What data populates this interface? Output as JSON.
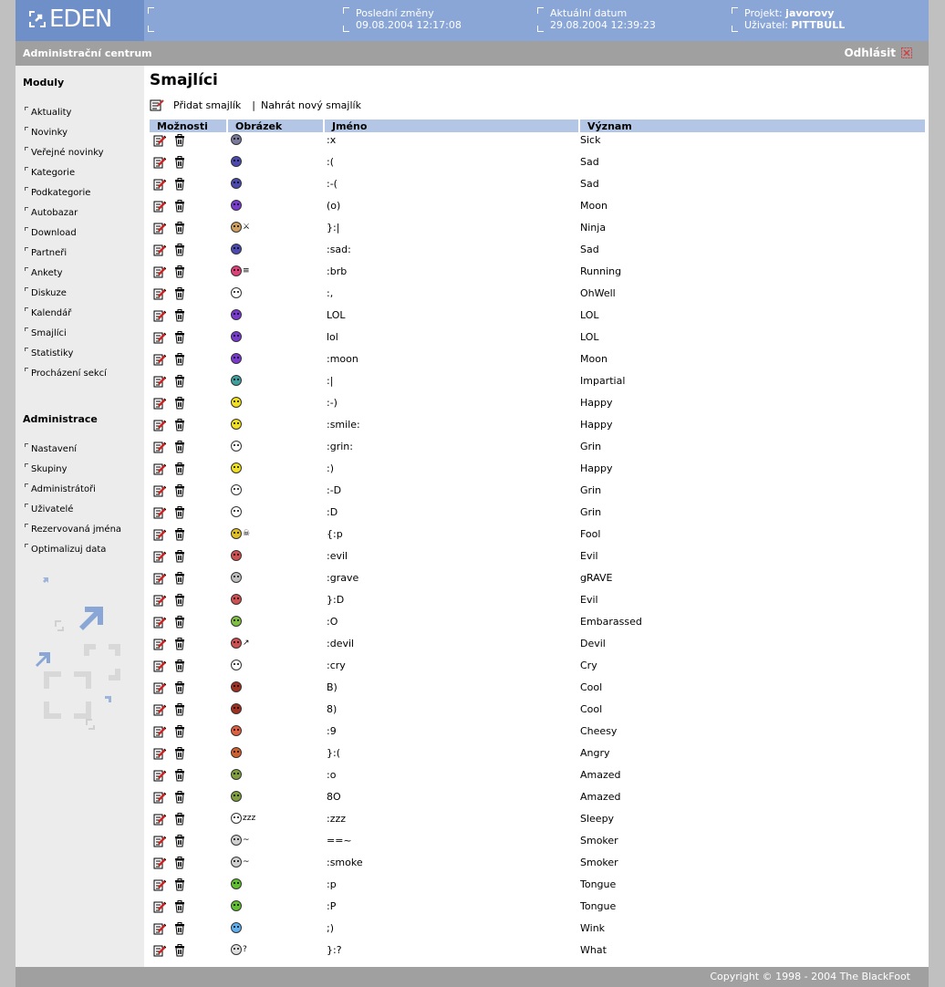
{
  "header": {
    "logo_text": "EDEN",
    "last_change_label": "Poslední změny",
    "last_change_value": "09.08.2004 12:17:08",
    "current_date_label": "Aktuální datum",
    "current_date_value": "29.08.2004 12:39:23",
    "project_label": "Projekt:",
    "project_value": "javorovy",
    "user_label": "Uživatel:",
    "user_value": "PITTBULL"
  },
  "adminbar": {
    "title": "Administrační centrum",
    "logout": "Odhlásit"
  },
  "sidebar": {
    "modules_heading": "Moduly",
    "modules": [
      "Aktuality",
      "Novinky",
      "Veřejné novinky",
      "Kategorie",
      "Podkategorie",
      "Autobazar",
      "Download",
      "Partneři",
      "Ankety",
      "Diskuze",
      "Kalendář",
      "Smajlíci",
      "Statistiky",
      "Procházení sekcí"
    ],
    "admin_heading": "Administrace",
    "admin": [
      "Nastavení",
      "Skupiny",
      "Administrátoři",
      "Uživatelé",
      "Rezervovaná jména",
      "Optimalizuj data"
    ]
  },
  "main": {
    "title": "Smajlíci",
    "add_label": "Přidat smajlík",
    "upload_label": "Nahrát nový smajlík",
    "separator": "|",
    "columns": [
      "Možnosti",
      "Obrázek",
      "Jméno",
      "Význam"
    ],
    "rows": [
      {
        "name": ":x",
        "meaning": "Sick",
        "color": "#7a7a9a",
        "extra": ""
      },
      {
        "name": ":(",
        "meaning": "Sad",
        "color": "#4a4ab0",
        "extra": ""
      },
      {
        "name": ":-(",
        "meaning": "Sad",
        "color": "#4a4ab0",
        "extra": ""
      },
      {
        "name": "(o)",
        "meaning": "Moon",
        "color": "#7a3ad0",
        "extra": ""
      },
      {
        "name": "}:|",
        "meaning": "Ninja",
        "color": "#d0a060",
        "extra": "⚔"
      },
      {
        "name": ":sad:",
        "meaning": "Sad",
        "color": "#4a4ab0",
        "extra": ""
      },
      {
        "name": ":brb",
        "meaning": "Running",
        "color": "#e0407a",
        "extra": "≡"
      },
      {
        "name": ":,",
        "meaning": "OhWell",
        "color": "#ffffff",
        "extra": ""
      },
      {
        "name": "LOL",
        "meaning": "LOL",
        "color": "#7a3ad0",
        "extra": ""
      },
      {
        "name": "lol",
        "meaning": "LOL",
        "color": "#7a3ad0",
        "extra": ""
      },
      {
        "name": ":moon",
        "meaning": "Moon",
        "color": "#7a3ad0",
        "extra": ""
      },
      {
        "name": ":|",
        "meaning": "Impartial",
        "color": "#40a0a0",
        "extra": ""
      },
      {
        "name": ":-)",
        "meaning": "Happy",
        "color": "#f0e020",
        "extra": ""
      },
      {
        "name": ":smile:",
        "meaning": "Happy",
        "color": "#f0e020",
        "extra": ""
      },
      {
        "name": ":grin:",
        "meaning": "Grin",
        "color": "#ffffff",
        "extra": ""
      },
      {
        "name": ":)",
        "meaning": "Happy",
        "color": "#f0e020",
        "extra": ""
      },
      {
        "name": ":-D",
        "meaning": "Grin",
        "color": "#ffffff",
        "extra": ""
      },
      {
        "name": ":D",
        "meaning": "Grin",
        "color": "#ffffff",
        "extra": ""
      },
      {
        "name": "{:p",
        "meaning": "Fool",
        "color": "#e0c020",
        "extra": "☠"
      },
      {
        "name": ":evil",
        "meaning": "Evil",
        "color": "#d05050",
        "extra": ""
      },
      {
        "name": ":grave",
        "meaning": "gRAVE",
        "color": "#c0c0c0",
        "extra": ""
      },
      {
        "name": "}:D",
        "meaning": "Evil",
        "color": "#d05050",
        "extra": ""
      },
      {
        "name": ":O",
        "meaning": "Embarassed",
        "color": "#80c040",
        "extra": ""
      },
      {
        "name": ":devil",
        "meaning": "Devil",
        "color": "#d05050",
        "extra": "↗"
      },
      {
        "name": ":cry",
        "meaning": "Cry",
        "color": "#ffffff",
        "extra": ""
      },
      {
        "name": "B)",
        "meaning": "Cool",
        "color": "#a03020",
        "extra": ""
      },
      {
        "name": "8)",
        "meaning": "Cool",
        "color": "#a03020",
        "extra": ""
      },
      {
        "name": ":9",
        "meaning": "Cheesy",
        "color": "#e06040",
        "extra": ""
      },
      {
        "name": "}:(",
        "meaning": "Angry",
        "color": "#d06030",
        "extra": ""
      },
      {
        "name": ":o",
        "meaning": "Amazed",
        "color": "#80a040",
        "extra": ""
      },
      {
        "name": "8O",
        "meaning": "Amazed",
        "color": "#80a040",
        "extra": ""
      },
      {
        "name": ":zzz",
        "meaning": "Sleepy",
        "color": "#ffffff",
        "extra": "zzz"
      },
      {
        "name": "==~",
        "meaning": "Smoker",
        "color": "#d0d0d0",
        "extra": "~"
      },
      {
        "name": ":smoke",
        "meaning": "Smoker",
        "color": "#d0d0d0",
        "extra": "~"
      },
      {
        "name": ":p",
        "meaning": "Tongue",
        "color": "#60c030",
        "extra": ""
      },
      {
        "name": ":P",
        "meaning": "Tongue",
        "color": "#60c030",
        "extra": ""
      },
      {
        "name": ";)",
        "meaning": "Wink",
        "color": "#60b0f0",
        "extra": ""
      },
      {
        "name": "}:?",
        "meaning": "What",
        "color": "#e0e0e0",
        "extra": "?"
      }
    ]
  },
  "footer": {
    "copyright": "Copyright © 1998 - 2004 The BlackFoot"
  },
  "icons": {
    "edit": "edit-icon",
    "delete": "trash-icon",
    "add": "add-smiley-icon",
    "logout": "logout-icon"
  }
}
